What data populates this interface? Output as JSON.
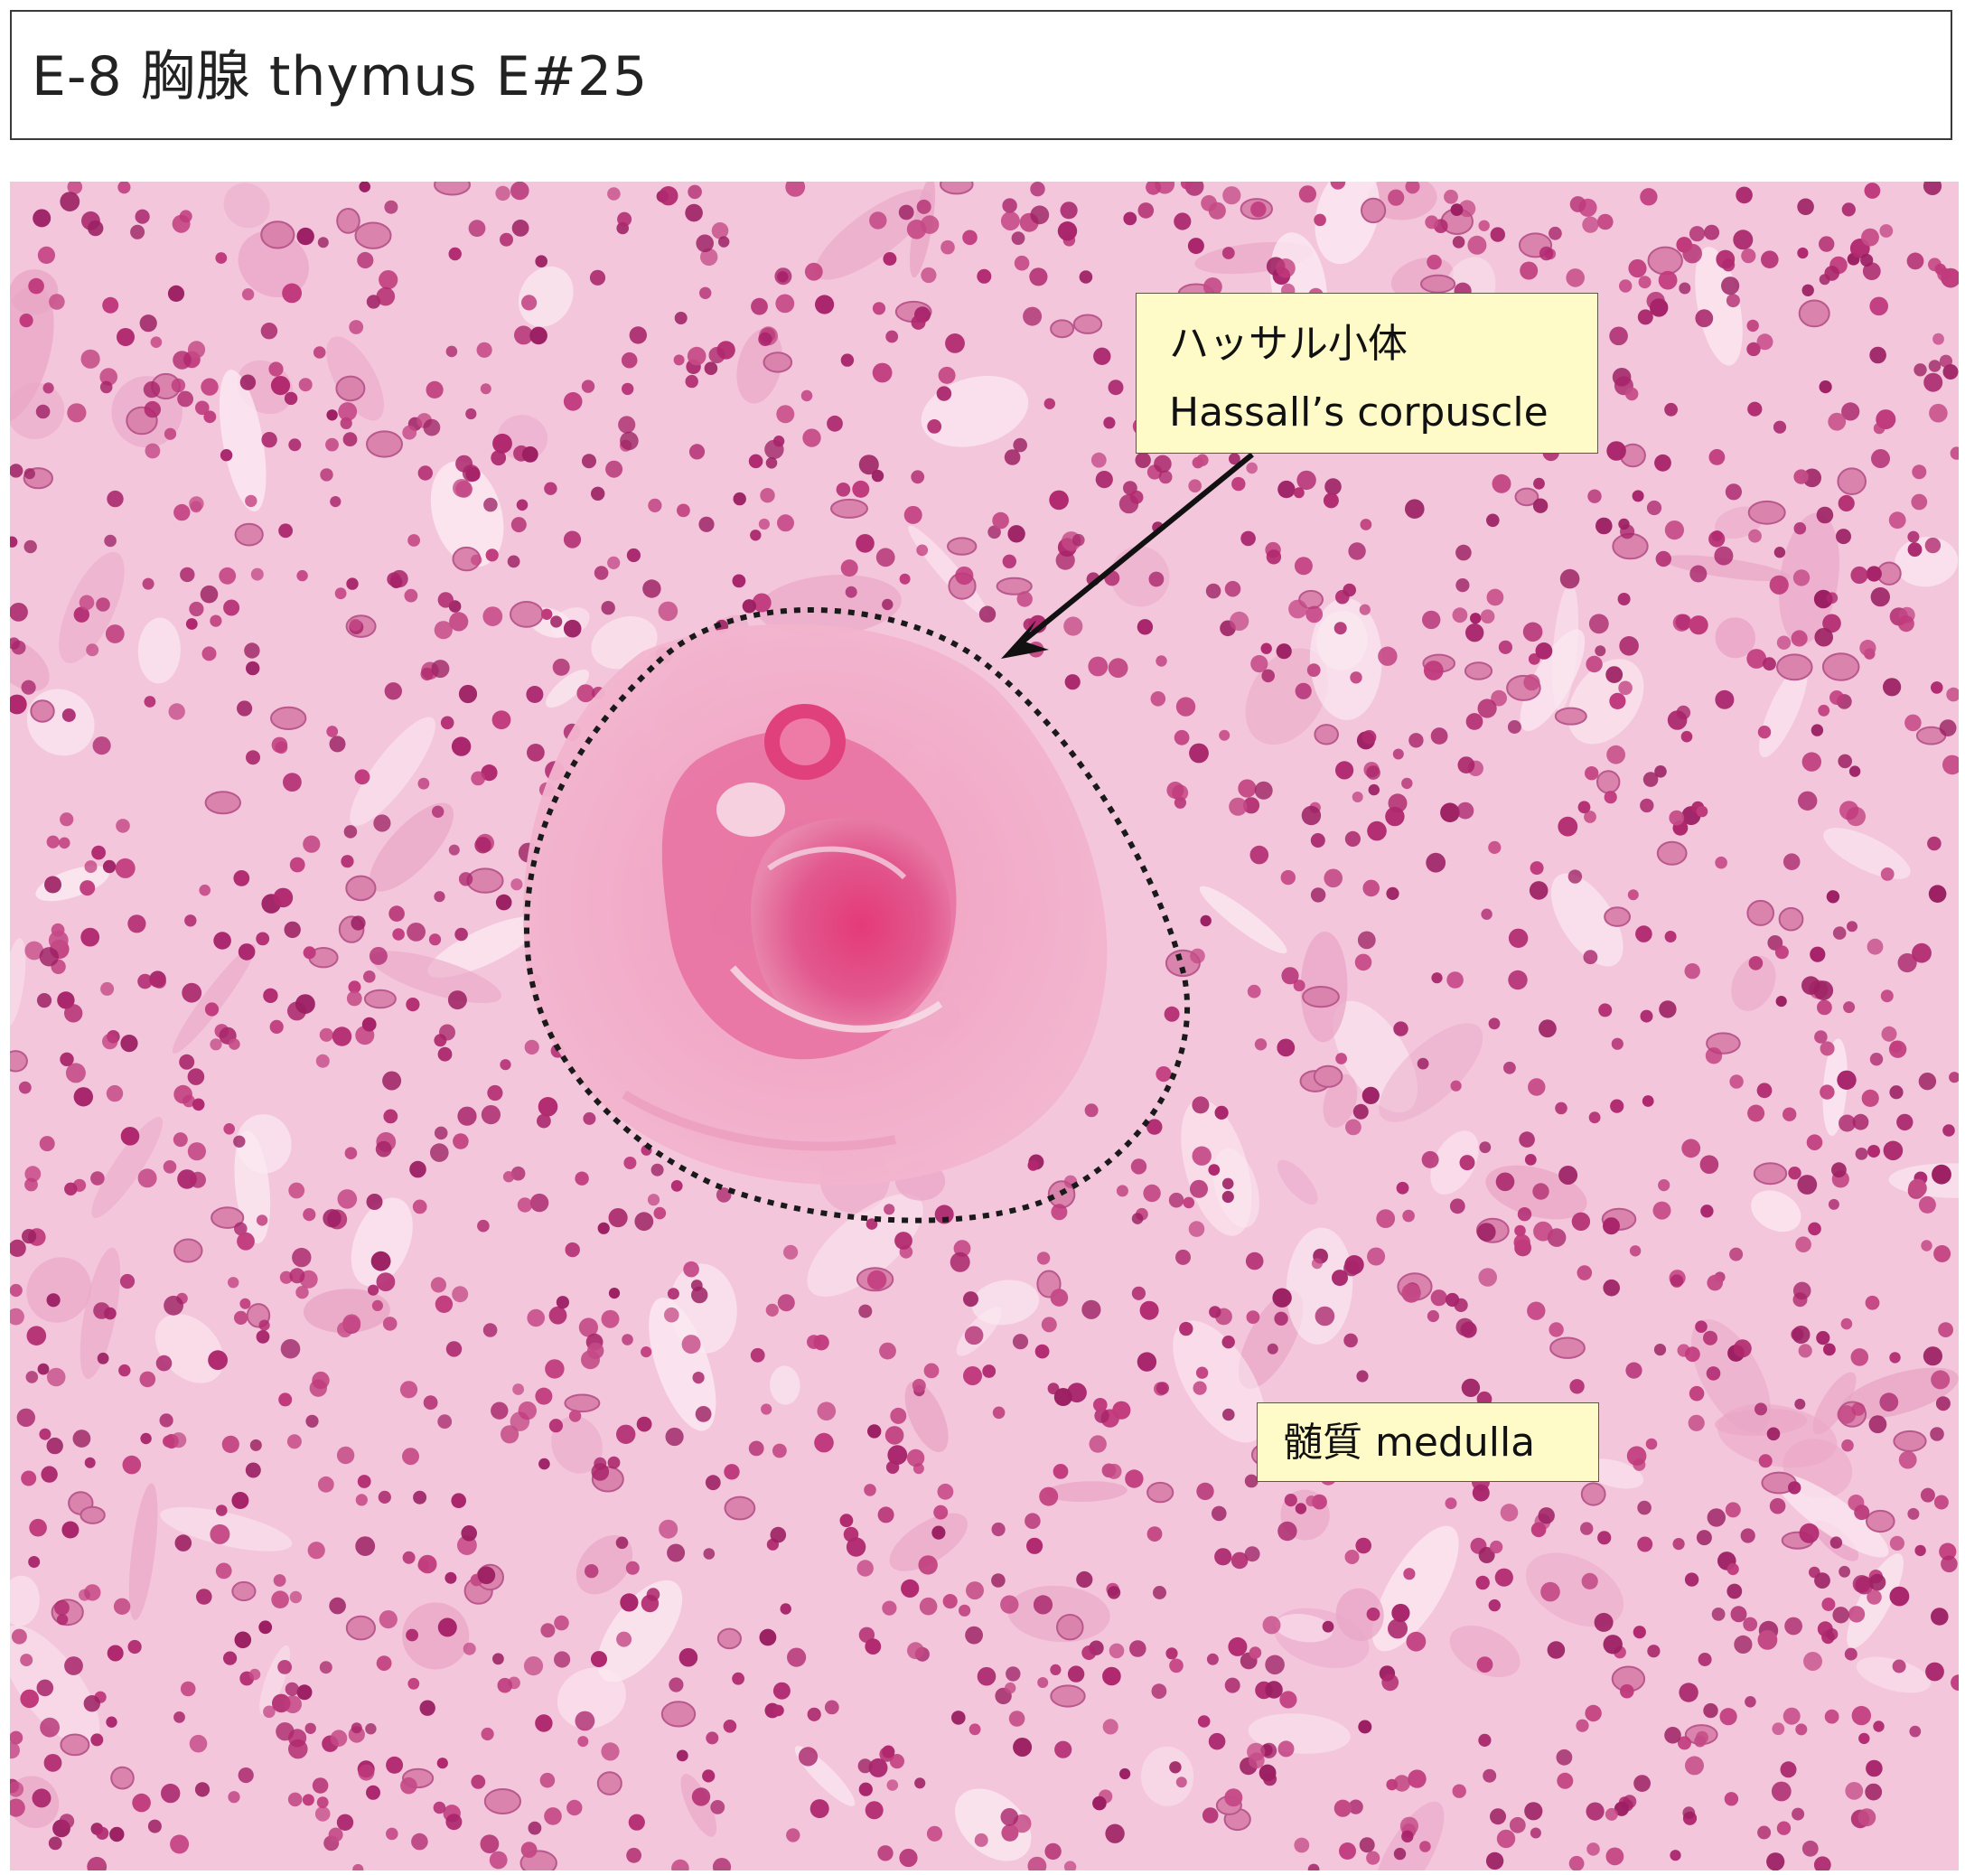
{
  "header": {
    "title": "E-8 胸腺 thymus E#25"
  },
  "labels": {
    "hassall_jp": "ハッサル小体",
    "hassall_en": "Hassall’s corpuscle",
    "medulla": "髄質 medulla"
  },
  "colors": {
    "label_background": "#fffbc8",
    "tissue_background": "#f5c8de",
    "nucleus": "#b0286e",
    "corpuscle_core": "#e0437e",
    "outline": "#1a1a1a"
  }
}
